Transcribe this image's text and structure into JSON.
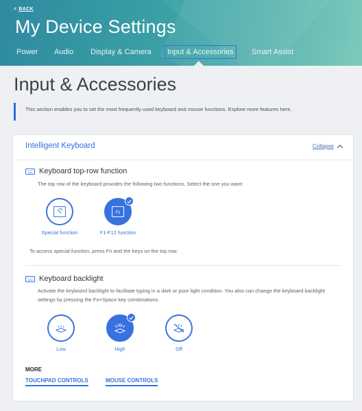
{
  "header": {
    "back_label": "BACK",
    "title": "My Device Settings",
    "tabs": [
      {
        "label": "Power"
      },
      {
        "label": "Audio"
      },
      {
        "label": "Display & Camera"
      },
      {
        "label": "Input & Accessories"
      },
      {
        "label": "Smart Assist"
      }
    ],
    "active_tab": "Input & Accessories"
  },
  "page": {
    "title": "Input & Accessories",
    "intro": "This section enables you to set the most frequently used keyboard and mouse functions. Explore more features here."
  },
  "card": {
    "title": "Intelligent Keyboard",
    "collapse_label": "Collapse",
    "top_row": {
      "title": "Keyboard top-row function",
      "description": "The top row of the keyboard provides the following two functions. Select the one you want:",
      "options": [
        {
          "label": "Special function",
          "selected": false,
          "icon": "special-function-key-icon"
        },
        {
          "label": "F1-F12 function",
          "selected": true,
          "icon": "f1-key-icon",
          "key_text": "F1"
        }
      ],
      "note": "To access special function, press Fn and the keys on the top row."
    },
    "backlight": {
      "title": "Keyboard backlight",
      "description": "Activate the keyboard backlight to facilitate typing in a dark or poor light condition. You also can change the keyboard backlight settings by pressing the Fn+Space key combinations.",
      "options": [
        {
          "label": "Low",
          "selected": false,
          "icon": "backlight-low-icon"
        },
        {
          "label": "High",
          "selected": true,
          "icon": "backlight-high-icon"
        },
        {
          "label": "Off",
          "selected": false,
          "icon": "backlight-off-icon"
        }
      ]
    },
    "more": {
      "label": "MORE",
      "links": [
        {
          "label": "TOUCHPAD CONTROLS"
        },
        {
          "label": "MOUSE CONTROLS"
        }
      ]
    }
  },
  "colors": {
    "accent": "#3772e0",
    "header_start": "#2f8aa0",
    "header_end": "#74c7b8",
    "background": "#eef0f3"
  }
}
